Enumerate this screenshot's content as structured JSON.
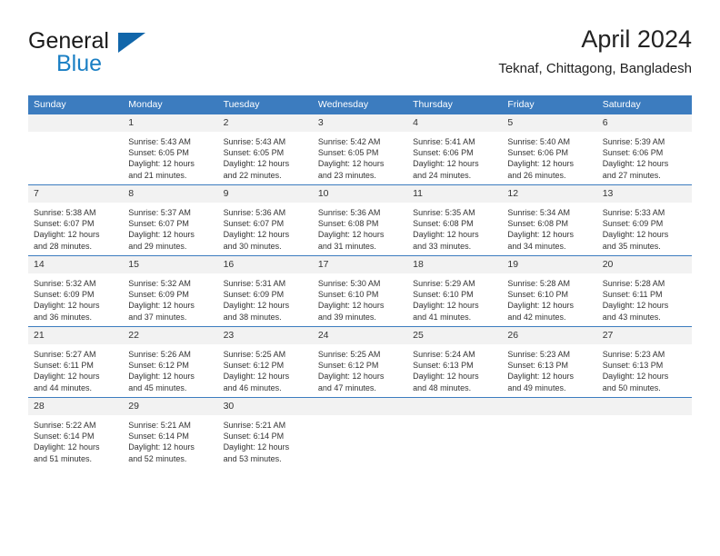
{
  "brand": {
    "name_part1": "General",
    "name_part2": "Blue",
    "logo_icon": "triangle-logo-icon",
    "accent_color": "#1a7fc4"
  },
  "header": {
    "month_title": "April 2024",
    "location": "Teknaf, Chittagong, Bangladesh"
  },
  "calendar": {
    "header_bg": "#3c7cbf",
    "daynum_bg": "#f2f2f2",
    "weekdays": [
      "Sunday",
      "Monday",
      "Tuesday",
      "Wednesday",
      "Thursday",
      "Friday",
      "Saturday"
    ],
    "weeks": [
      [
        {
          "day": "",
          "lines": []
        },
        {
          "day": "1",
          "lines": [
            "Sunrise: 5:43 AM",
            "Sunset: 6:05 PM",
            "Daylight: 12 hours",
            "and 21 minutes."
          ]
        },
        {
          "day": "2",
          "lines": [
            "Sunrise: 5:43 AM",
            "Sunset: 6:05 PM",
            "Daylight: 12 hours",
            "and 22 minutes."
          ]
        },
        {
          "day": "3",
          "lines": [
            "Sunrise: 5:42 AM",
            "Sunset: 6:05 PM",
            "Daylight: 12 hours",
            "and 23 minutes."
          ]
        },
        {
          "day": "4",
          "lines": [
            "Sunrise: 5:41 AM",
            "Sunset: 6:06 PM",
            "Daylight: 12 hours",
            "and 24 minutes."
          ]
        },
        {
          "day": "5",
          "lines": [
            "Sunrise: 5:40 AM",
            "Sunset: 6:06 PM",
            "Daylight: 12 hours",
            "and 26 minutes."
          ]
        },
        {
          "day": "6",
          "lines": [
            "Sunrise: 5:39 AM",
            "Sunset: 6:06 PM",
            "Daylight: 12 hours",
            "and 27 minutes."
          ]
        }
      ],
      [
        {
          "day": "7",
          "lines": [
            "Sunrise: 5:38 AM",
            "Sunset: 6:07 PM",
            "Daylight: 12 hours",
            "and 28 minutes."
          ]
        },
        {
          "day": "8",
          "lines": [
            "Sunrise: 5:37 AM",
            "Sunset: 6:07 PM",
            "Daylight: 12 hours",
            "and 29 minutes."
          ]
        },
        {
          "day": "9",
          "lines": [
            "Sunrise: 5:36 AM",
            "Sunset: 6:07 PM",
            "Daylight: 12 hours",
            "and 30 minutes."
          ]
        },
        {
          "day": "10",
          "lines": [
            "Sunrise: 5:36 AM",
            "Sunset: 6:08 PM",
            "Daylight: 12 hours",
            "and 31 minutes."
          ]
        },
        {
          "day": "11",
          "lines": [
            "Sunrise: 5:35 AM",
            "Sunset: 6:08 PM",
            "Daylight: 12 hours",
            "and 33 minutes."
          ]
        },
        {
          "day": "12",
          "lines": [
            "Sunrise: 5:34 AM",
            "Sunset: 6:08 PM",
            "Daylight: 12 hours",
            "and 34 minutes."
          ]
        },
        {
          "day": "13",
          "lines": [
            "Sunrise: 5:33 AM",
            "Sunset: 6:09 PM",
            "Daylight: 12 hours",
            "and 35 minutes."
          ]
        }
      ],
      [
        {
          "day": "14",
          "lines": [
            "Sunrise: 5:32 AM",
            "Sunset: 6:09 PM",
            "Daylight: 12 hours",
            "and 36 minutes."
          ]
        },
        {
          "day": "15",
          "lines": [
            "Sunrise: 5:32 AM",
            "Sunset: 6:09 PM",
            "Daylight: 12 hours",
            "and 37 minutes."
          ]
        },
        {
          "day": "16",
          "lines": [
            "Sunrise: 5:31 AM",
            "Sunset: 6:09 PM",
            "Daylight: 12 hours",
            "and 38 minutes."
          ]
        },
        {
          "day": "17",
          "lines": [
            "Sunrise: 5:30 AM",
            "Sunset: 6:10 PM",
            "Daylight: 12 hours",
            "and 39 minutes."
          ]
        },
        {
          "day": "18",
          "lines": [
            "Sunrise: 5:29 AM",
            "Sunset: 6:10 PM",
            "Daylight: 12 hours",
            "and 41 minutes."
          ]
        },
        {
          "day": "19",
          "lines": [
            "Sunrise: 5:28 AM",
            "Sunset: 6:10 PM",
            "Daylight: 12 hours",
            "and 42 minutes."
          ]
        },
        {
          "day": "20",
          "lines": [
            "Sunrise: 5:28 AM",
            "Sunset: 6:11 PM",
            "Daylight: 12 hours",
            "and 43 minutes."
          ]
        }
      ],
      [
        {
          "day": "21",
          "lines": [
            "Sunrise: 5:27 AM",
            "Sunset: 6:11 PM",
            "Daylight: 12 hours",
            "and 44 minutes."
          ]
        },
        {
          "day": "22",
          "lines": [
            "Sunrise: 5:26 AM",
            "Sunset: 6:12 PM",
            "Daylight: 12 hours",
            "and 45 minutes."
          ]
        },
        {
          "day": "23",
          "lines": [
            "Sunrise: 5:25 AM",
            "Sunset: 6:12 PM",
            "Daylight: 12 hours",
            "and 46 minutes."
          ]
        },
        {
          "day": "24",
          "lines": [
            "Sunrise: 5:25 AM",
            "Sunset: 6:12 PM",
            "Daylight: 12 hours",
            "and 47 minutes."
          ]
        },
        {
          "day": "25",
          "lines": [
            "Sunrise: 5:24 AM",
            "Sunset: 6:13 PM",
            "Daylight: 12 hours",
            "and 48 minutes."
          ]
        },
        {
          "day": "26",
          "lines": [
            "Sunrise: 5:23 AM",
            "Sunset: 6:13 PM",
            "Daylight: 12 hours",
            "and 49 minutes."
          ]
        },
        {
          "day": "27",
          "lines": [
            "Sunrise: 5:23 AM",
            "Sunset: 6:13 PM",
            "Daylight: 12 hours",
            "and 50 minutes."
          ]
        }
      ],
      [
        {
          "day": "28",
          "lines": [
            "Sunrise: 5:22 AM",
            "Sunset: 6:14 PM",
            "Daylight: 12 hours",
            "and 51 minutes."
          ]
        },
        {
          "day": "29",
          "lines": [
            "Sunrise: 5:21 AM",
            "Sunset: 6:14 PM",
            "Daylight: 12 hours",
            "and 52 minutes."
          ]
        },
        {
          "day": "30",
          "lines": [
            "Sunrise: 5:21 AM",
            "Sunset: 6:14 PM",
            "Daylight: 12 hours",
            "and 53 minutes."
          ]
        },
        {
          "day": "",
          "lines": []
        },
        {
          "day": "",
          "lines": []
        },
        {
          "day": "",
          "lines": []
        },
        {
          "day": "",
          "lines": []
        }
      ]
    ]
  }
}
